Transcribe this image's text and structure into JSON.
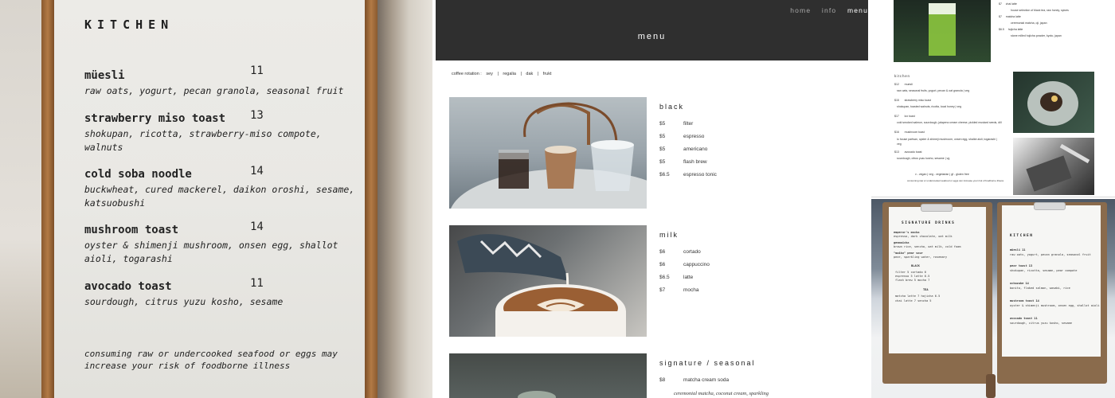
{
  "left_menu": {
    "title": "KITCHEN",
    "items": [
      {
        "name": "müesli",
        "price": "11",
        "desc": "raw oats, yogurt, pecan granola, seasonal fruit"
      },
      {
        "name": "strawberry miso toast",
        "price": "13",
        "desc": "shokupan, ricotta, strawberry-miso compote, walnuts"
      },
      {
        "name": "cold soba noodle",
        "price": "14",
        "desc": "buckwheat, cured mackerel, daikon oroshi, sesame, katsuobushi"
      },
      {
        "name": "mushroom toast",
        "price": "14",
        "desc": "oyster & shimenji mushroom, onsen egg, shallot aioli, togarashi"
      },
      {
        "name": "avocado toast",
        "price": "11",
        "desc": "sourdough, citrus yuzu kosho, sesame"
      }
    ],
    "note": "consuming raw or undercooked seafood or eggs may increase your risk of foodborne illness"
  },
  "site": {
    "nav": [
      "home",
      "info",
      "menu"
    ],
    "active_nav": "menu",
    "title": "menu",
    "rotation_label": "coffee rotation :",
    "rotation": [
      "sey",
      "|",
      "regalia",
      "|",
      "dak",
      "|",
      "frukt"
    ],
    "sections": [
      {
        "title": "black",
        "items": [
          {
            "price": "$5",
            "name": "filter"
          },
          {
            "price": "$5",
            "name": "espresso"
          },
          {
            "price": "$5",
            "name": "americano"
          },
          {
            "price": "$5",
            "name": "flash brew"
          },
          {
            "price": "$6.5",
            "name": "espresso tonic"
          }
        ]
      },
      {
        "title": "milk",
        "items": [
          {
            "price": "$6",
            "name": "cortado"
          },
          {
            "price": "$6",
            "name": "cappuccino"
          },
          {
            "price": "$6.5",
            "name": "latte"
          },
          {
            "price": "$7",
            "name": "mocha"
          }
        ]
      },
      {
        "title": "signature / seasonal",
        "items": [
          {
            "price": "$8",
            "name": "matcha cream soda"
          }
        ],
        "sub": "ceremonial matcha, coconut cream, sparkling"
      }
    ]
  },
  "snapshot": {
    "top_lines": [
      {
        "p": "$7",
        "t": "chai latte"
      },
      {
        "p": "",
        "t": "house selection of black tea, raw honey, spices"
      },
      {
        "p": "$7",
        "t": "matcha latte"
      },
      {
        "p": "",
        "t": "ceremonial matcha, oji, japan"
      },
      {
        "p": "$6.5",
        "t": "hojicha latte"
      },
      {
        "p": "",
        "t": "stone milled hojicha powder, kyoto, japan"
      }
    ],
    "kitchen_title": "kitchen",
    "kitchen_items": [
      {
        "p": "$12",
        "t": "muesli",
        "d": "raw oats, seasonal fruits, yogurt, pecan & oat granola  |  veg"
      },
      {
        "p": "$15",
        "t": "strawberry miso toast",
        "d": "shokupan, toasted walnuts, ricotta, local honey  |  veg"
      },
      {
        "p": "$17",
        "t": "lox toast",
        "d": "cold smoked salmon, sourdough, jalapeno cream cheese, pickled mustard seeds, dill"
      },
      {
        "p": "$16",
        "t": "mushroom toast",
        "d": "lo house parfsan, oyster & shimeji mushroom, onsen egg, shallot aioli, togarashi  |  veg"
      },
      {
        "p": "$13",
        "t": "avocado toast",
        "d": "sourdough, citrus yuzu kosho, sesame  |  vg"
      }
    ],
    "legend": "v - vegan   |   veg - vegetarian   |   gf - gluten free",
    "legend_note": "consuming raw or undercooked seafood or eggs can increase your risk of foodborne illness"
  },
  "boards": {
    "left_title": "SIGNATURE DRINKS",
    "left_lines": [
      {
        "t": "emperor's mocha",
        "b": true
      },
      {
        "t": "espresso, dark chocolate, oat milk",
        "b": false
      },
      {
        "t": "genmaicha",
        "b": true
      },
      {
        "t": "brown rice, sencha, oat milk, cold foam",
        "b": false
      },
      {
        "t": "\"maiko\" pear sour",
        "b": true
      },
      {
        "t": "pear, sparkling water, rosemary",
        "b": false
      },
      {
        "t": "BLACK",
        "b": true
      },
      {
        "t": "filter  5    cortado  6",
        "b": false
      },
      {
        "t": "espresso  5    latte  6.5",
        "b": false
      },
      {
        "t": "flash brew  5    mocha  7",
        "b": false
      },
      {
        "t": "TEA",
        "b": true
      },
      {
        "t": "matcha latte  7    hojicha  6.5",
        "b": false
      },
      {
        "t": "chai latte  7    sencha  5",
        "b": false
      }
    ],
    "right_title": "KITCHEN",
    "right_lines": [
      {
        "t": "müesli                11",
        "b": true
      },
      {
        "t": "raw oats, yogurt, pecan granola, seasonal fruit",
        "b": false
      },
      {
        "t": "pear toast            13",
        "b": true
      },
      {
        "t": "shokupan, ricotta, sesame, pear compote",
        "b": false
      },
      {
        "t": "ochazuke              14",
        "b": true
      },
      {
        "t": "bonito, flaked salmon, wasabi, rice",
        "b": false
      },
      {
        "t": "mushroom toast        14",
        "b": true
      },
      {
        "t": "oyster & shimenji mushroom, onsen egg, shallot aioli",
        "b": false
      },
      {
        "t": "avocado toast         11",
        "b": true
      },
      {
        "t": "sourdough, citrus yuzu kosho, sesame",
        "b": false
      }
    ]
  }
}
